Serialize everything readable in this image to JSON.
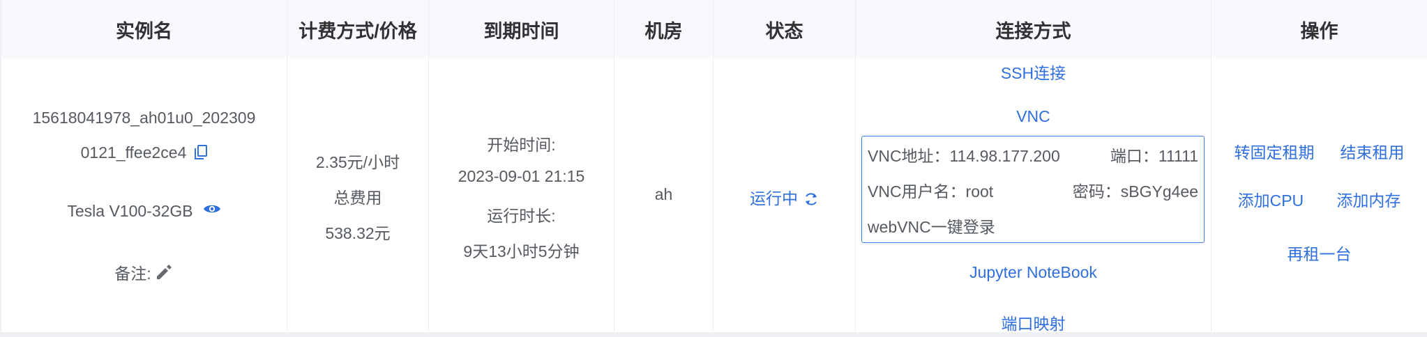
{
  "columns": [
    "实例名",
    "计费方式/价格",
    "到期时间",
    "机房",
    "状态",
    "连接方式",
    "操作"
  ],
  "row": {
    "instance": {
      "name_line1": "15618041978_ah01u0_202309",
      "name_line2": "0121_ffee2ce4",
      "copy_icon": "copy-icon",
      "gpu": "Tesla V100-32GB",
      "eye_icon": "eye-icon",
      "remark_label": "备注:",
      "edit_icon": "pencil-icon"
    },
    "billing": {
      "price": "2.35元/小时",
      "total_label": "总费用",
      "total_value": "538.32元"
    },
    "expiry": {
      "start_label": "开始时间:",
      "start_value": "2023-09-01 21:15",
      "duration_label": "运行时长:",
      "duration_value": "9天13小时5分钟"
    },
    "room": "ah",
    "status": {
      "text": "运行中",
      "icon": "refresh-icon"
    },
    "connection": {
      "ssh": "SSH连接",
      "vnc": "VNC",
      "vnc_address": "VNC地址：114.98.177.200",
      "vnc_port": "端口：11111",
      "vnc_user": "VNC用户名：root",
      "vnc_password": "密码：sBGYg4ee",
      "webvnc": "webVNC一键登录",
      "jupyter": "Jupyter NoteBook",
      "port_map": "端口映射"
    },
    "actions": {
      "to_fixed": "转固定租期",
      "end_rent": "结束租用",
      "add_cpu": "添加CPU",
      "add_memory": "添加内存",
      "rent_again": "再租一台"
    }
  },
  "colors": {
    "link": "#2f6fe0",
    "header_bg": "#f7f9fc",
    "text": "#555a61",
    "header_text": "#303133",
    "border": "#eceef2"
  }
}
